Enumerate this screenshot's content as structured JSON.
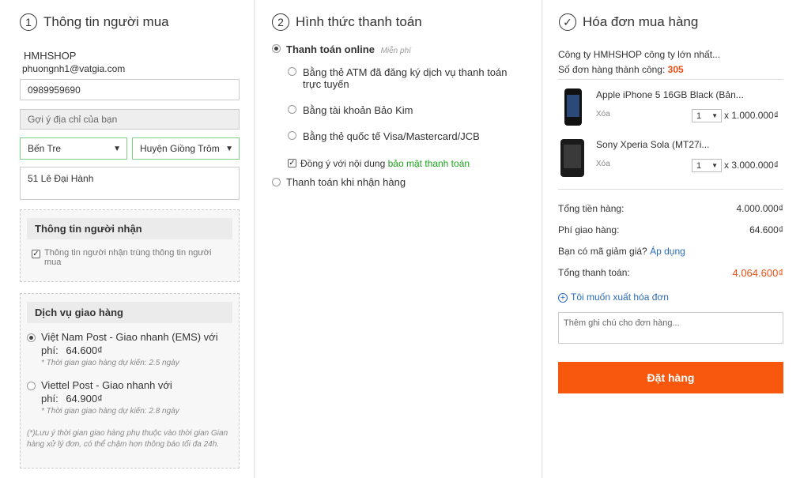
{
  "buyer": {
    "section_num": "1",
    "title": "Thông tin người mua",
    "name": "HMHSHOP",
    "email": "phuongnh1@vatgia.com",
    "phone": "0989959690",
    "address_hint": "Gợi ý địa chỉ của bạn",
    "province": "Bến Tre",
    "district": "Huyện Giồng Trôm",
    "address": "51 Lê Đại Hành",
    "receiver": {
      "title": "Thông tin người nhận",
      "same_label": "Thông tin người nhận trùng thông tin người mua"
    },
    "shipping": {
      "title": "Dịch vụ giao hàng",
      "options": [
        {
          "label": "Việt Nam Post - Giao nhanh (EMS) với",
          "fee_label": "phí:",
          "fee": "64.600₫",
          "eta": "* Thời gian giao hàng dự kiến: 2.5 ngày"
        },
        {
          "label": "Viettel Post - Giao nhanh với",
          "fee_label": "phí:",
          "fee": "64.900₫",
          "eta": "* Thời gian giao hàng dự kiến: 2.8 ngày"
        }
      ],
      "note": "(*)Lưu ý thời gian giao hàng phụ thuộc vào thời gian Gian hàng xử lý đơn, có thể chậm hơn thông báo tối đa 24h."
    }
  },
  "payment": {
    "section_num": "2",
    "title": "Hình thức thanh toán",
    "online_label": "Thanh toán online",
    "online_badge": "Miễn phí",
    "methods": [
      "Bằng thẻ ATM đã đăng ký dịch vụ thanh toán trực tuyến",
      "Bằng tài khoản Bảo Kim",
      "Bằng thẻ quốc tế Visa/Mastercard/JCB"
    ],
    "agree_prefix": "Đồng ý với nội dung",
    "agree_link": "bảo mật thanh toán",
    "cod_label": "Thanh toán khi nhận hàng"
  },
  "invoice": {
    "title": "Hóa đơn mua hàng",
    "shop": "Công ty HMHSHOP công ty lớn nhất...",
    "success_label": "Số đơn hàng thành công:",
    "success_count": "305",
    "items": [
      {
        "name": "Apple iPhone 5 16GB Black (Bản...",
        "remove": "Xóa",
        "qty": "1",
        "price": "x 1.000.000₫"
      },
      {
        "name": "Sony Xperia Sola (MT27i...",
        "remove": "Xóa",
        "qty": "1",
        "price": "x 3.000.000₫"
      }
    ],
    "subtotal_label": "Tổng tiền hàng:",
    "subtotal": "4.000.000₫",
    "shipping_label": "Phí giao hàng:",
    "shipping_fee": "64.600₫",
    "coupon_label": "Bạn có mã giảm giá?",
    "coupon_link": "Áp dụng",
    "total_label": "Tổng thanh toán:",
    "total": "4.064.600₫",
    "invoice_link": "Tôi muốn xuất hóa đơn",
    "note_placeholder": "Thêm ghi chú cho đơn hàng...",
    "order_button": "Đặt hàng"
  },
  "colors": {
    "accent": "#f7580e",
    "link_green": "#1ba21b",
    "link_blue": "#2a6ab8"
  }
}
